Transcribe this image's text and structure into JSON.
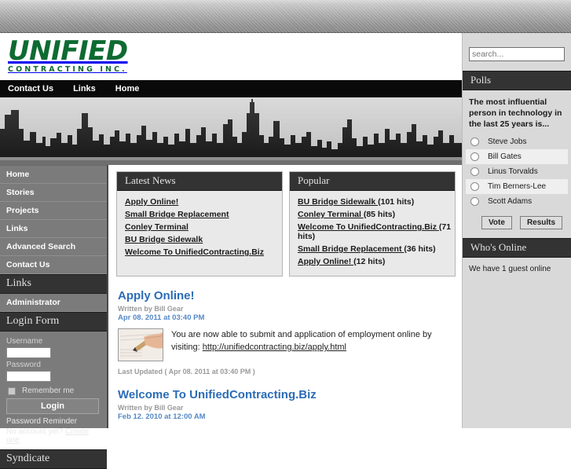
{
  "site": {
    "logo_main": "UNIFIED",
    "logo_sub": "CONTRACTING INC.",
    "logo_color": "#0e6b31"
  },
  "topnav": {
    "items": [
      {
        "label": "Contact Us"
      },
      {
        "label": "Links"
      },
      {
        "label": "Home"
      }
    ]
  },
  "sidebar": {
    "menu_title": "",
    "items": [
      {
        "label": "Home"
      },
      {
        "label": "Stories"
      },
      {
        "label": "Projects"
      },
      {
        "label": "Links"
      },
      {
        "label": "Advanced Search"
      },
      {
        "label": "Contact Us"
      }
    ],
    "links_heading": "Links",
    "administrator_label": "Administrator",
    "login": {
      "heading": "Login Form",
      "username_label": "Username",
      "username_value": "",
      "password_label": "Password",
      "password_value": "",
      "remember_label": "Remember me",
      "login_button": "Login",
      "password_reminder": "Password Reminder",
      "no_account_text": "No account yet? ",
      "create_one": "Create one"
    },
    "syndicate_heading": "Syndicate"
  },
  "content": {
    "latest_news": {
      "title": "Latest News",
      "items": [
        {
          "label": "Apply Online!"
        },
        {
          "label": "Small Bridge Replacement"
        },
        {
          "label": "Conley Terminal"
        },
        {
          "label": "BU Bridge Sidewalk"
        },
        {
          "label": "Welcome To UnifiedContracting.Biz"
        }
      ]
    },
    "popular": {
      "title": "Popular",
      "items": [
        {
          "label": "BU Bridge Sidewalk ",
          "hits": "(101 hits)"
        },
        {
          "label": "Conley Terminal ",
          "hits": "(85 hits)"
        },
        {
          "label": "Welcome To UnifiedContracting.Biz ",
          "hits": "(71 hits)"
        },
        {
          "label": "Small Bridge Replacement ",
          "hits": "(36 hits)"
        },
        {
          "label": "Apply Online! ",
          "hits": "(12 hits)"
        }
      ]
    },
    "articles": [
      {
        "title": "Apply Online!",
        "byline": "Written by Bill Gear",
        "date": "Apr 08. 2011 at 03:40 PM",
        "body_before_link": "You are now able to submit and application of employment online by visiting: ",
        "body_link": "http://unifiedcontracting.biz/apply.html",
        "last_updated": "Last Updated ( Apr 08. 2011 at 03:40 PM )",
        "thumb_alt": "hand-writing-on-paper-photo"
      },
      {
        "title": "Welcome To UnifiedContracting.Biz",
        "byline": "Written by Bill Gear",
        "date": "Feb 12. 2010 at 12:00 AM"
      }
    ]
  },
  "right": {
    "search_placeholder": "search...",
    "search_value": "",
    "polls": {
      "title": "Polls",
      "question": "The most influential person in technology in the last 25 years is...",
      "options": [
        {
          "label": "Steve Jobs"
        },
        {
          "label": "Bill Gates"
        },
        {
          "label": "Linus Torvalds"
        },
        {
          "label": "Tim Berners-Lee"
        },
        {
          "label": "Scott Adams"
        }
      ],
      "vote_button": "Vote",
      "results_button": "Results"
    },
    "whos_online": {
      "title": "Who's Online",
      "text": "We have 1 guest online"
    }
  }
}
